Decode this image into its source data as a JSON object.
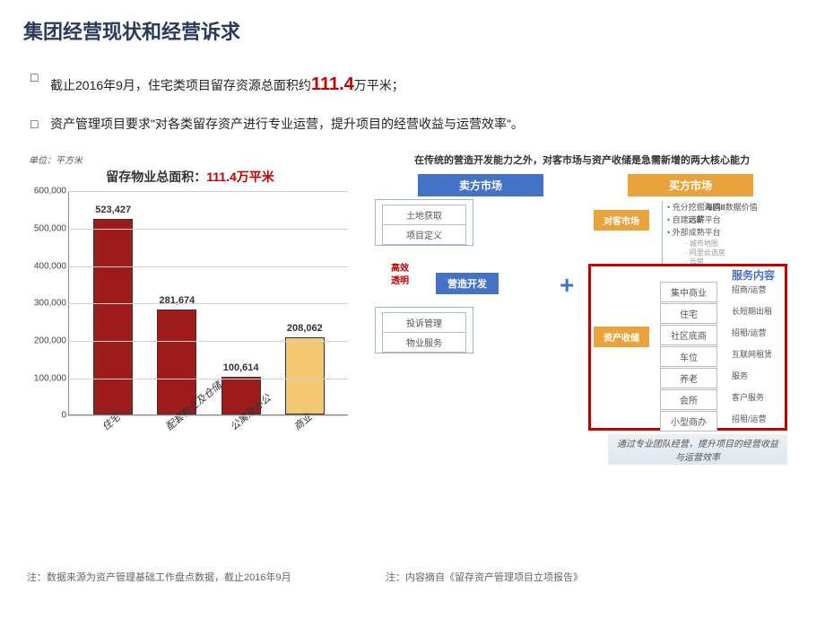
{
  "title": "集团经营现状和经营诉求",
  "bullets": {
    "b1_prefix": "截止2016年9月，住宅类项目留存资源总面积约",
    "b1_highlight": "111.4",
    "b1_suffix": "万平米；",
    "b2_prefix": "资产管理项目要求\"对各类留存资产进行专业运营，提升项目的经营收益与运营效率\"。"
  },
  "chart_data": {
    "type": "bar",
    "unit_label": "单位：平方米",
    "title_prefix": "留存物业总面积：",
    "title_highlight": "111.4万平米",
    "categories": [
      "住宅",
      "配套物业及仓储",
      "公寓及办公",
      "商业"
    ],
    "values": [
      523427,
      281674,
      100614,
      208062
    ],
    "series_colors": [
      "dark",
      "dark",
      "dark",
      "light"
    ],
    "ylim": [
      0,
      600000
    ],
    "ylabel": "",
    "y_ticks": [
      0,
      100000,
      200000,
      300000,
      400000,
      500000,
      600000
    ],
    "y_tick_labels": [
      "0",
      "100,000",
      "200,000",
      "300,000",
      "400,000",
      "500,000",
      "600,000"
    ],
    "data_labels": [
      "523,427",
      "281,674",
      "100,614",
      "208,062"
    ]
  },
  "diagram": {
    "headline": "在传统的营造开发能力之外，对客市场与资产收储是急需新增的两大核心能力",
    "seller_header": "卖方市场",
    "buyer_header": "买方市场",
    "left_boxes": [
      "土地获取",
      "项目定义"
    ],
    "left_tag1a": "高效",
    "left_tag1b": "透明",
    "mid_box": "营造开发",
    "left_boxes2": [
      "投诉管理",
      "物业服务"
    ],
    "plus": "+",
    "customer_tag": "对客市场",
    "customer_bullets": [
      {
        "text": "充分挖掘海鸥II数据价值",
        "bold": "海鸥II"
      },
      {
        "text": "自建远薪平台",
        "bold": "远薪"
      },
      {
        "text": "外部成熟平台",
        "bold": ""
      }
    ],
    "customer_subs": [
      "城市地图",
      "阿里云选房",
      "云房"
    ],
    "asset_tag": "资产收储",
    "service_title": "服务内容",
    "asset_boxes": [
      "集中商业",
      "住宅",
      "社区底商",
      "车位",
      "养老",
      "会所",
      "小型商办"
    ],
    "service_right": [
      "招商/运营",
      "长短期出租",
      "招租/运营",
      "互联网租赁",
      "服务",
      "客户服务",
      "招租/运营"
    ],
    "caption": "通过专业团队经营，提升项目的经营收益与运营效率"
  },
  "footnotes": {
    "left": "注：数据来源为资产管理基础工作盘点数据，截止2016年9月",
    "right": "注：内容摘自《留存资产管理项目立项报告》"
  }
}
